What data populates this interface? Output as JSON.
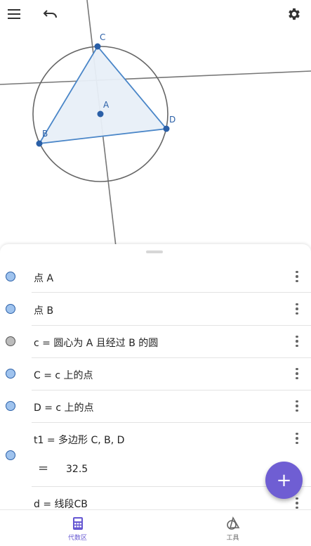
{
  "graphics": {
    "points": [
      {
        "label": "A"
      },
      {
        "label": "B"
      },
      {
        "label": "C"
      },
      {
        "label": "D"
      }
    ],
    "colors": {
      "point": "#2a5fa7",
      "polygon_fill": "#e8eff8",
      "polygon_stroke": "#4a86c8",
      "circle": "#666666",
      "line": "#777777"
    }
  },
  "algebra": {
    "items": [
      {
        "text": "点 A"
      },
      {
        "text": "点 B"
      },
      {
        "text": "c = 圆心为 A 且经过 B 的圆"
      },
      {
        "text": "C = c 上的点"
      },
      {
        "text": "D = c 上的点"
      },
      {
        "text": "t1 = 多边形 C, B, D",
        "value_symbol": "=",
        "value": "32.5"
      },
      {
        "text": "d = 线段CB"
      }
    ]
  },
  "fab": {
    "symbol": "+"
  },
  "bottom_nav": {
    "tabs": [
      {
        "label": "代数区",
        "icon": "calculator-icon",
        "active": true,
        "color": "#6557d2"
      },
      {
        "label": "工具",
        "icon": "shapes-tools-icon",
        "active": false,
        "color": "#666666"
      }
    ]
  }
}
